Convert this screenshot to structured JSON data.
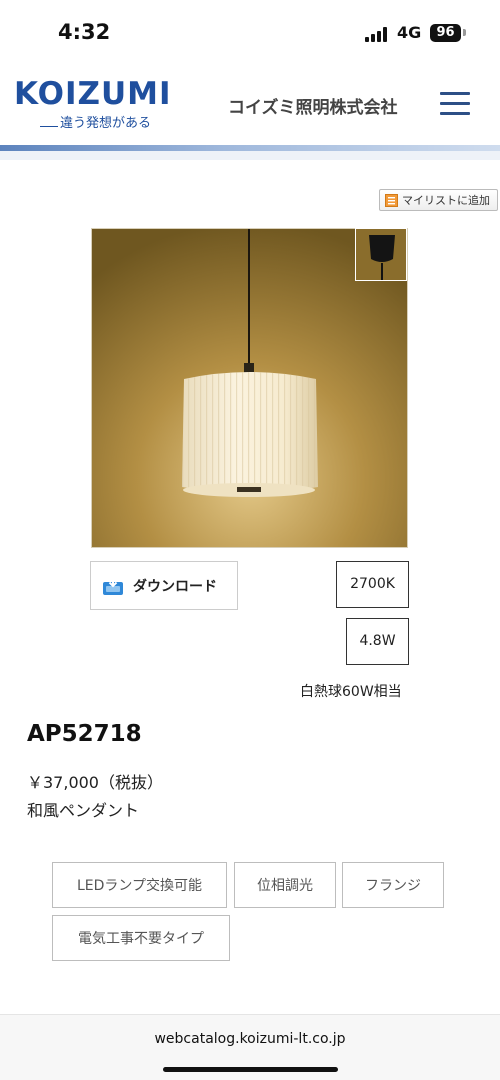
{
  "status_bar": {
    "time": "4:32",
    "network": "4G",
    "battery": "96"
  },
  "header": {
    "logo": "KOIZUMI",
    "tagline": "違う発想がある",
    "company_name": "コイズミ照明株式会社",
    "brand_color": "#1f4f9e"
  },
  "mylist_button": {
    "label": "マイリストに追加"
  },
  "download_button": {
    "label": "ダウンロード"
  },
  "specs": {
    "color_temp": "2700K",
    "wattage": "4.8W",
    "equivalent": "白熱球60W相当"
  },
  "product": {
    "code": "AP52718",
    "price": "￥37,000（税抜）",
    "category": "和風ペンダント"
  },
  "tags": [
    "LEDランプ交換可能",
    "位相調光",
    "フランジ",
    "電気工事不要タイプ"
  ],
  "browser": {
    "url": "webcatalog.koizumi-lt.co.jp"
  },
  "icons": {
    "menu": "hamburger-icon",
    "mylist": "list-add-icon",
    "download": "download-icon"
  }
}
